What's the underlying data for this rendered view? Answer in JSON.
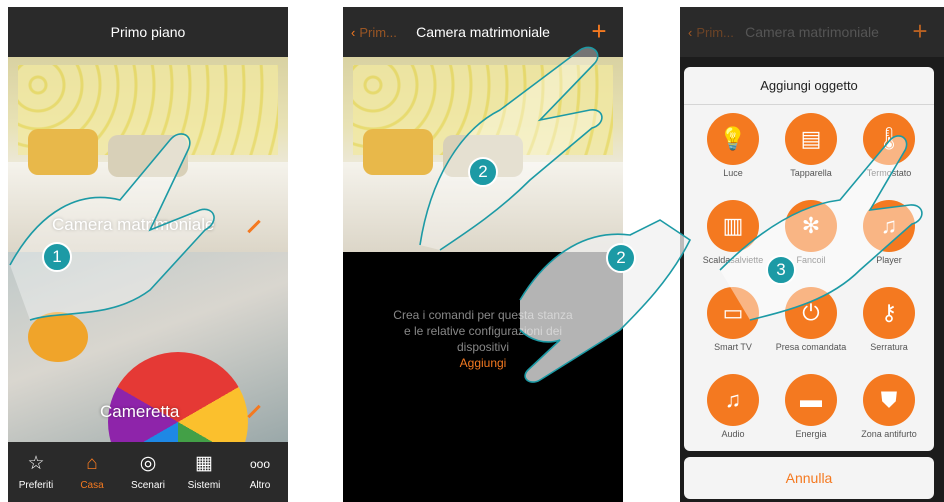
{
  "screen1": {
    "title": "Primo piano",
    "rooms": [
      {
        "label": "Camera matrimoniale"
      },
      {
        "label": "Cameretta"
      }
    ],
    "nav": [
      {
        "label": "Preferiti",
        "icon": "star-icon",
        "glyph": "☆"
      },
      {
        "label": "Casa",
        "icon": "home-icon",
        "glyph": "⌂",
        "active": true
      },
      {
        "label": "Scenari",
        "icon": "scenario-icon",
        "glyph": "◎"
      },
      {
        "label": "Sistemi",
        "icon": "grid-icon",
        "glyph": "▦"
      },
      {
        "label": "Altro",
        "icon": "more-icon",
        "glyph": "ooo"
      }
    ],
    "step_badge": "1"
  },
  "screen2": {
    "back_label": "Prim...",
    "title": "Camera matrimoniale",
    "add_glyph": "+",
    "message_line1": "Crea i comandi per questa stanza",
    "message_line2": "e le relative configurazioni dei",
    "message_line3": "dispositivi",
    "add_link": "Aggiungi",
    "step_badge_top": "2",
    "step_badge_mid": "2"
  },
  "screen3": {
    "back_label": "Prim...",
    "title": "Camera matrimoniale",
    "add_glyph": "+",
    "modal_title": "Aggiungi oggetto",
    "objects": [
      {
        "label": "Luce",
        "icon": "bulb-icon",
        "glyph": "💡"
      },
      {
        "label": "Tapparella",
        "icon": "shutter-icon",
        "glyph": "▤"
      },
      {
        "label": "Termostato",
        "icon": "thermostat-icon",
        "glyph": "🌡"
      },
      {
        "label": "Scaldasalviette",
        "icon": "towel-warmer-icon",
        "glyph": "▥"
      },
      {
        "label": "Fancoil",
        "icon": "fancoil-icon",
        "glyph": "✻"
      },
      {
        "label": "Player",
        "icon": "music-icon",
        "glyph": "♫"
      },
      {
        "label": "Smart TV",
        "icon": "tv-icon",
        "glyph": "▭"
      },
      {
        "label": "Presa comandata",
        "icon": "plug-icon",
        "glyph": "⏻"
      },
      {
        "label": "Serratura",
        "icon": "key-icon",
        "glyph": "⚷"
      },
      {
        "label": "Audio",
        "icon": "audio-icon",
        "glyph": "♫"
      },
      {
        "label": "Energia",
        "icon": "battery-icon",
        "glyph": "▬"
      },
      {
        "label": "Zona antifurto",
        "icon": "shield-icon",
        "glyph": "⛊"
      }
    ],
    "cancel_label": "Annulla",
    "step_badge": "3"
  },
  "colors": {
    "accent": "#f47920",
    "bar": "#2a2a2a",
    "badge": "#1c9aa5"
  }
}
